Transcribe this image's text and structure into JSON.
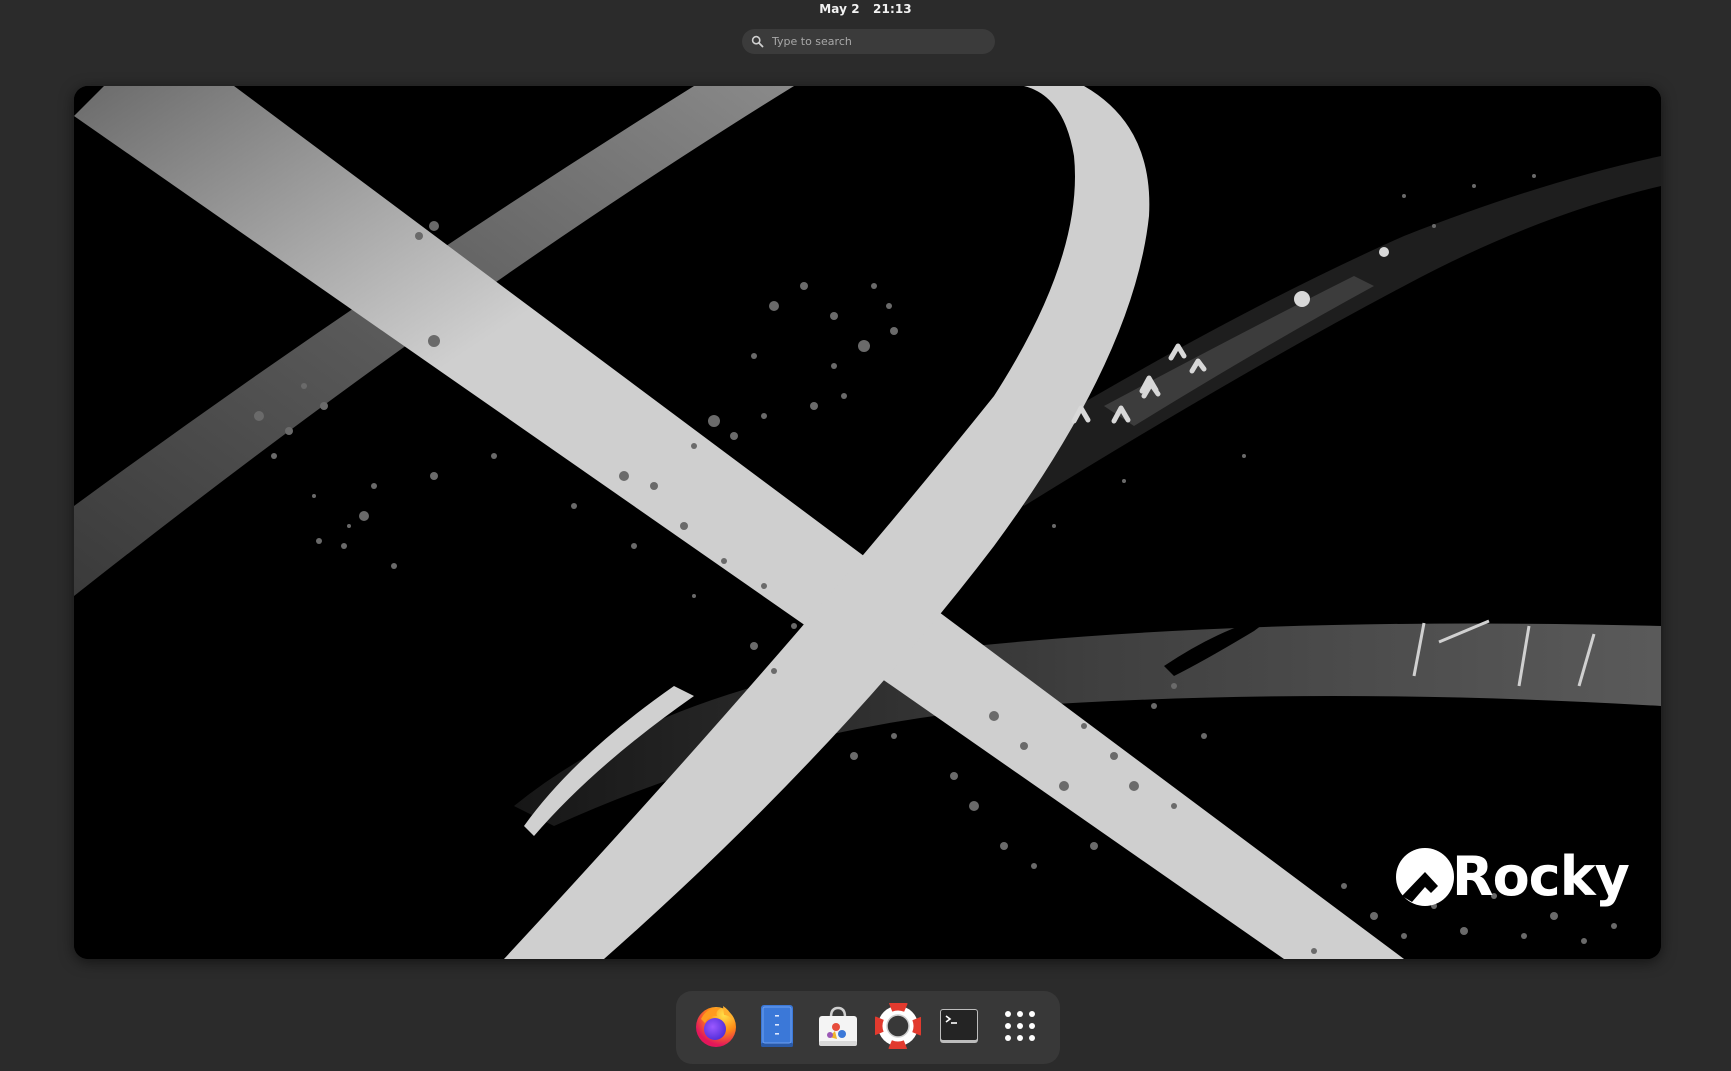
{
  "topbar": {
    "date": "May 2",
    "time": "21:13"
  },
  "search": {
    "placeholder": "Type to search",
    "icon": "search-icon"
  },
  "workspace": {
    "logo_text": "Rocky"
  },
  "dash": {
    "items": [
      {
        "name": "firefox",
        "icon": "firefox-icon"
      },
      {
        "name": "files",
        "icon": "files-icon"
      },
      {
        "name": "software",
        "icon": "software-icon"
      },
      {
        "name": "help",
        "icon": "help-icon"
      },
      {
        "name": "terminal",
        "icon": "terminal-icon"
      },
      {
        "name": "show-apps",
        "icon": "app-grid-icon"
      }
    ]
  },
  "colors": {
    "background": "#2b2b2b",
    "dash_background": "#383838",
    "search_background": "#3b3b3b",
    "wallpaper_stroke": "#cfcfcf"
  }
}
